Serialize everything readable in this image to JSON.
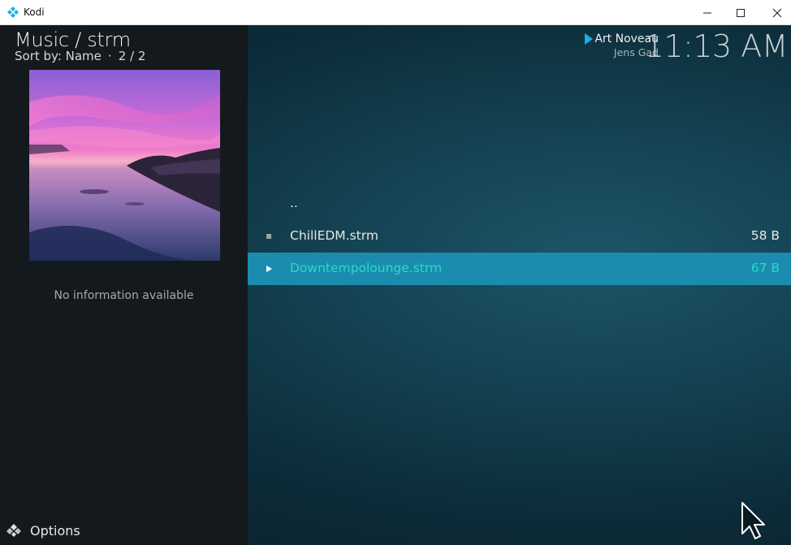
{
  "window": {
    "title": "Kodi",
    "controls": [
      "minimize-icon",
      "maximize-icon",
      "close-icon"
    ]
  },
  "header": {
    "title": "Music / strm",
    "sort_label": "Sort by: Name",
    "separator": "·",
    "count": "2 / 2"
  },
  "sidebar": {
    "info_text": "No information available",
    "options_label": "Options",
    "options_icon": "options-icon"
  },
  "now_playing": {
    "title": "Art Noveau",
    "artist": "Jens Gad",
    "icon": "play-icon"
  },
  "clock": "11:13 AM",
  "list": {
    "items": [
      {
        "name": "..",
        "size": "",
        "icon": ""
      },
      {
        "name": "ChillEDM.strm",
        "size": "58 B",
        "icon": "square-icon"
      },
      {
        "name": "Downtempolounge.strm",
        "size": "67 B",
        "icon": "play-icon",
        "selected": true
      }
    ]
  },
  "colors": {
    "accent": "#1b8cb0",
    "selected_text": "#2bd9c4",
    "sidebar_bg": "#14191d"
  }
}
